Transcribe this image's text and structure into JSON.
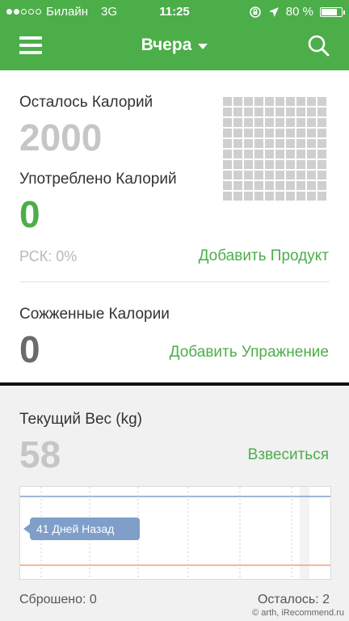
{
  "status_bar": {
    "carrier": "Билайн",
    "network": "3G",
    "time": "11:25",
    "battery": "80 %",
    "battery_level": 0.8,
    "signal_bars_filled": 2,
    "signal_bars_total": 5
  },
  "navbar": {
    "title": "Вчера",
    "menu_icon": "hamburger-menu-icon",
    "search_icon": "search-icon"
  },
  "calories": {
    "remaining_label": "Осталось Калорий",
    "remaining_value": "2000",
    "consumed_label": "Употреблено Калорий",
    "consumed_value": "0",
    "rsk": "РСК: 0%",
    "add_food": "Добавить Продукт"
  },
  "burned": {
    "label": "Сожженные Калории",
    "value": "0",
    "add_exercise": "Добавить Упражнение"
  },
  "weight": {
    "label": "Текущий Вес (kg)",
    "value": "58",
    "weigh_in": "Взвеситься",
    "tooltip": "41 Дней Назад",
    "lost": "Сброшено: 0",
    "left": "Осталось: 2"
  },
  "watermark": "© arth, iRecommend.ru",
  "colors": {
    "brand_green": "#4cae49",
    "grey_value": "#c6c6c6",
    "dark_value": "#6b6b6b",
    "chart_blue": "#7f9fc9",
    "chart_orange": "#f0a37a"
  }
}
